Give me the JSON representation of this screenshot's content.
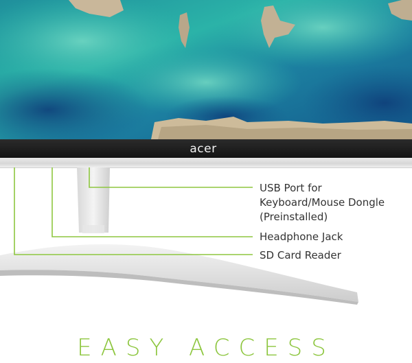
{
  "product": {
    "brand": "acer"
  },
  "callouts": [
    {
      "line1": "USB Port for",
      "line2": "Keyboard/Mouse Dongle",
      "line3": "(Preinstalled)"
    },
    {
      "line1": "Headphone Jack"
    },
    {
      "line1": "SD Card Reader"
    }
  ],
  "headline": "EASY ACCESS",
  "colors": {
    "accent": "#8dc63f",
    "bezel": "#1c1c1c",
    "text": "#333333"
  }
}
